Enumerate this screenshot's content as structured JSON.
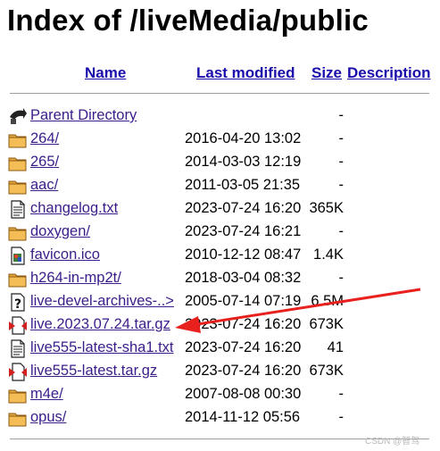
{
  "page": {
    "title": "Index of /liveMedia/public"
  },
  "table": {
    "headers": {
      "name": "Name",
      "modified": "Last modified",
      "size": "Size",
      "description": "Description"
    },
    "rows": [
      {
        "name": "Parent Directory",
        "modified": "",
        "size": "-",
        "icon": "back-arrow-icon"
      },
      {
        "name": "264/",
        "modified": "2016-04-20 13:02",
        "size": "-",
        "icon": "folder-icon"
      },
      {
        "name": "265/",
        "modified": "2014-03-03 12:19",
        "size": "-",
        "icon": "folder-icon"
      },
      {
        "name": "aac/",
        "modified": "2011-03-05 21:35",
        "size": "-",
        "icon": "folder-icon"
      },
      {
        "name": "changelog.txt",
        "modified": "2023-07-24 16:20",
        "size": "365K",
        "icon": "text-file-icon"
      },
      {
        "name": "doxygen/",
        "modified": "2023-07-24 16:21",
        "size": "-",
        "icon": "folder-icon"
      },
      {
        "name": "favicon.ico",
        "modified": "2010-12-12 08:47",
        "size": "1.4K",
        "icon": "image-file-icon"
      },
      {
        "name": "h264-in-mp2t/",
        "modified": "2018-03-04 08:32",
        "size": "-",
        "icon": "folder-icon"
      },
      {
        "name": "live-devel-archives-..>",
        "modified": "2005-07-14 07:19",
        "size": "6.5M",
        "icon": "unknown-file-icon"
      },
      {
        "name": "live.2023.07.24.tar.gz",
        "modified": "2023-07-24 16:20",
        "size": "673K",
        "icon": "compressed-file-icon"
      },
      {
        "name": "live555-latest-sha1.txt",
        "modified": "2023-07-24 16:20",
        "size": "41",
        "icon": "text-file-icon"
      },
      {
        "name": "live555-latest.tar.gz",
        "modified": "2023-07-24 16:20",
        "size": "673K",
        "icon": "compressed-file-icon"
      },
      {
        "name": "m4e/",
        "modified": "2007-08-08 00:30",
        "size": "-",
        "icon": "folder-icon"
      },
      {
        "name": "opus/",
        "modified": "2014-11-12 05:56",
        "size": "-",
        "icon": "folder-icon"
      }
    ]
  },
  "annotation": {
    "arrow_color": "#e8201e",
    "icon": "red-arrow-pointer"
  },
  "watermark": "CSDN @智驾"
}
